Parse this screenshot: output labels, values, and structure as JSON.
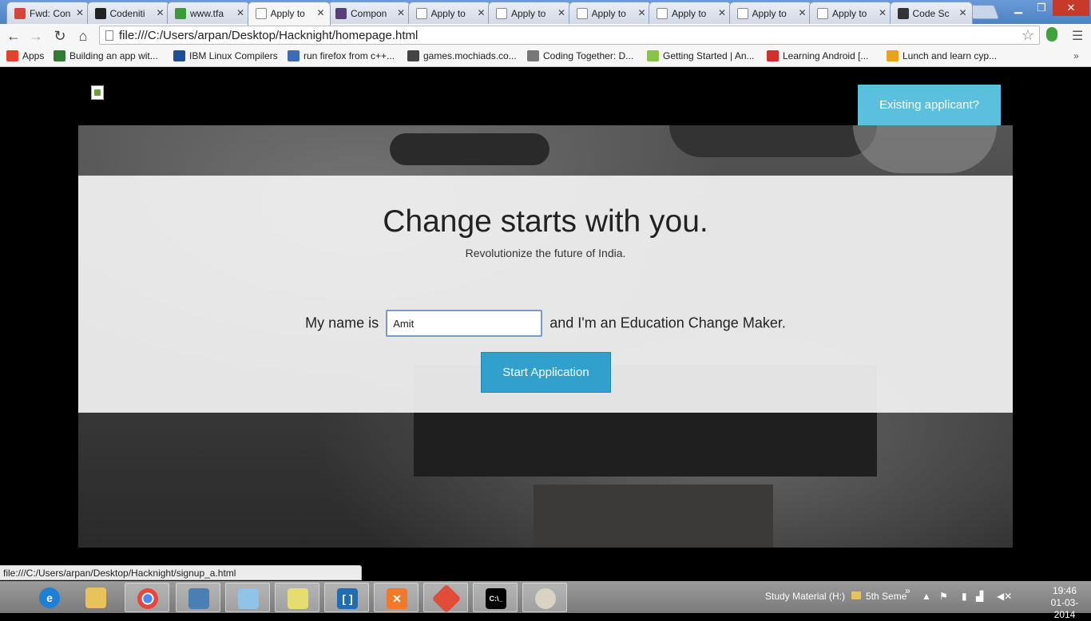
{
  "browser": {
    "tabs": [
      {
        "label": "Fwd: Con",
        "icon": "gmail-icon",
        "color": "#d44638"
      },
      {
        "label": "Codeniti",
        "icon": "github-icon",
        "color": "#222222"
      },
      {
        "label": "www.tfa",
        "icon": "check-icon",
        "color": "#3b9a3b"
      },
      {
        "label": "Apply to",
        "icon": "page-icon",
        "color": "#ffffff",
        "active": true
      },
      {
        "label": "Compon",
        "icon": "bootstrap-icon",
        "color": "#563d7c"
      },
      {
        "label": "Apply to",
        "icon": "page-icon",
        "color": "#ffffff"
      },
      {
        "label": "Apply to",
        "icon": "page-icon",
        "color": "#ffffff"
      },
      {
        "label": "Apply to",
        "icon": "page-icon",
        "color": "#ffffff"
      },
      {
        "label": "Apply to",
        "icon": "page-icon",
        "color": "#ffffff"
      },
      {
        "label": "Apply to",
        "icon": "page-icon",
        "color": "#ffffff"
      },
      {
        "label": "Apply to",
        "icon": "page-icon",
        "color": "#ffffff"
      },
      {
        "label": "Code Sc",
        "icon": "codeschool-icon",
        "color": "#333333"
      }
    ],
    "close_glyph": "✕",
    "url": "file:///C:/Users/arpan/Desktop/Hacknight/homepage.html",
    "bookmarks": [
      {
        "label": "Apps",
        "icon": "apps-grid-icon",
        "color": "#e0452b"
      },
      {
        "label": "Building an app wit...",
        "icon": "bookmark-app-icon",
        "color": "#2e7d32"
      },
      {
        "label": "IBM Linux Compilers",
        "icon": "ibm-icon",
        "color": "#1f4e99"
      },
      {
        "label": "run firefox from c++...",
        "icon": "stackoverflow-icon",
        "color": "#3b6cb5"
      },
      {
        "label": "games.mochiads.co...",
        "icon": "mochi-icon",
        "color": "#444444"
      },
      {
        "label": "Coding Together: D...",
        "icon": "apple-icon",
        "color": "#777777"
      },
      {
        "label": "Getting Started | An...",
        "icon": "android-icon",
        "color": "#8bc34a"
      },
      {
        "label": "Learning Android [...",
        "icon": "pdf-icon",
        "color": "#d32f2f"
      },
      {
        "label": "Lunch and learn cyp...",
        "icon": "cyp-icon",
        "color": "#e9a21c"
      }
    ],
    "status_url": "file:///C:/Users/arpan/Desktop/Hacknight/signup_a.html"
  },
  "page": {
    "existing_label": "Existing applicant?",
    "headline": "Change starts with you.",
    "subline": "Revolutionize the future of India.",
    "name_prefix": "My name is",
    "name_value": "Amit",
    "name_suffix": "and I'm an Education Change Maker.",
    "start_label": "Start Application",
    "accent": "#5bc0de",
    "button_color": "#31a0cc"
  },
  "taskbar": {
    "tray_drive": "Study Material (H:)",
    "tray_folder": "5th Seme",
    "more": "»",
    "time": "19:46",
    "date": "01-03-2014"
  }
}
